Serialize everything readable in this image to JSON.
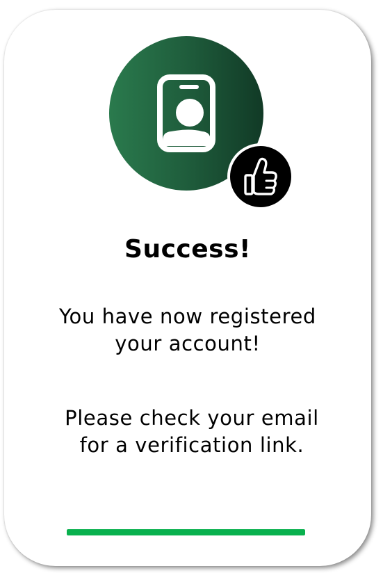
{
  "dialog": {
    "title": "Success!",
    "message_registered": "You have now registered\nyour account!",
    "message_verify": "Please check your email\nfor a verification link.",
    "icons": {
      "main": "id-badge-icon",
      "overlay": "thumbs-up-icon"
    },
    "progress": {
      "fraction": 1.0
    },
    "colors": {
      "circle_start": "#2a7a4d",
      "circle_end": "#113a26",
      "progress": "#09b14e"
    }
  }
}
